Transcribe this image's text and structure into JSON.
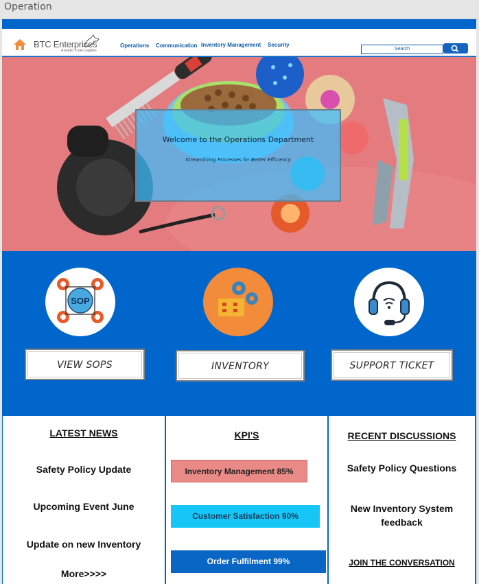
{
  "window": {
    "title": "Operation"
  },
  "header": {
    "brand": "BTC Enterprises",
    "tagline": "A leader in pet supplies",
    "nav": [
      {
        "label": "Operations"
      },
      {
        "label": "Communication"
      },
      {
        "label": "Inventory Management"
      },
      {
        "label": "Security"
      }
    ],
    "search": {
      "placeholder": "Search"
    }
  },
  "hero": {
    "title": "Welcome to the Operations Department",
    "subtitle": "Streamlining Processes for Better Efficiency"
  },
  "actions": [
    {
      "icon": "sop-gears-icon",
      "label": "VIEW SOPS",
      "icon_text": "SOP"
    },
    {
      "icon": "inventory-boxes-icon",
      "label": "INVENTORY"
    },
    {
      "icon": "headset-support-icon",
      "label": "SUPPORT TICKET"
    }
  ],
  "news": {
    "heading": "LATEST NEWS",
    "items": [
      "Safety  Policy Update",
      "Upcoming Event June",
      "Update on new Inventory"
    ],
    "more": "More>>>>"
  },
  "kpis": {
    "heading": "KPI'S",
    "items": [
      {
        "label": "Inventory Management 85%",
        "value": 85,
        "color": "#e98a86"
      },
      {
        "label": "Customer Satisfaction 90%",
        "value": 90,
        "color": "#16c6f7"
      },
      {
        "label": "Order Fulfilment 99%",
        "value": 99,
        "color": "#0a66c4"
      }
    ]
  },
  "discussions": {
    "heading": "RECENT DISCUSSIONS",
    "items": [
      "Safety Policy Questions",
      "New Inventory System feedback"
    ],
    "join": "JOIN THE CONVERSATION"
  },
  "colors": {
    "brand_blue": "#0066cc",
    "hero_bg": "#e47c7f",
    "orange": "#f28c3b"
  }
}
